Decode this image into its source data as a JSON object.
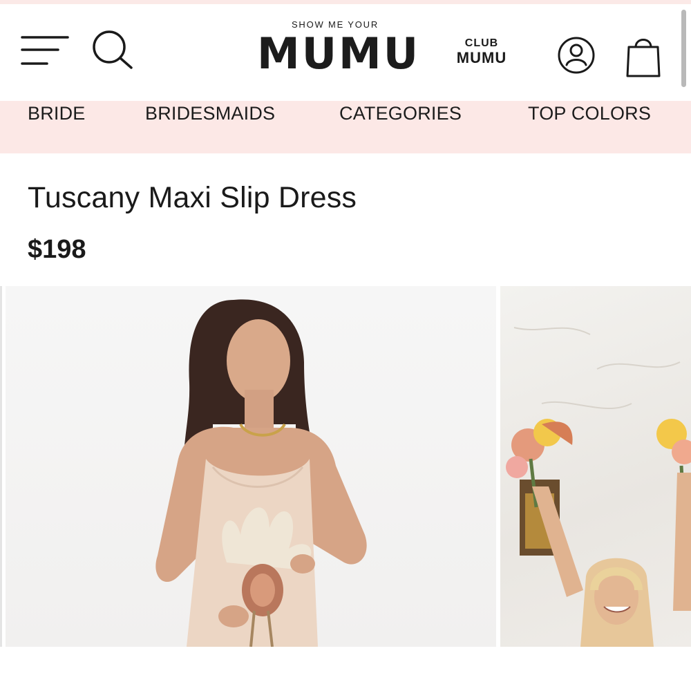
{
  "header": {
    "logo_small": "SHOW ME YOUR",
    "logo_big": "MUMU",
    "club_top": "CLUB",
    "club_bottom": "MUMU",
    "icons": [
      "menu-icon",
      "search-icon",
      "account-icon",
      "cart-icon"
    ]
  },
  "nav": {
    "items": [
      {
        "label": "BRIDE"
      },
      {
        "label": "BRIDESMAIDS"
      },
      {
        "label": "CATEGORIES"
      },
      {
        "label": "TOP COLORS"
      }
    ]
  },
  "product": {
    "title": "Tuscany Maxi Slip Dress",
    "price": "$198"
  },
  "gallery": {
    "images": [
      "model-photo",
      "bridesmaids-photo"
    ]
  },
  "colors": {
    "nav_background": "#fce8e6",
    "text": "#1a1a1a"
  }
}
